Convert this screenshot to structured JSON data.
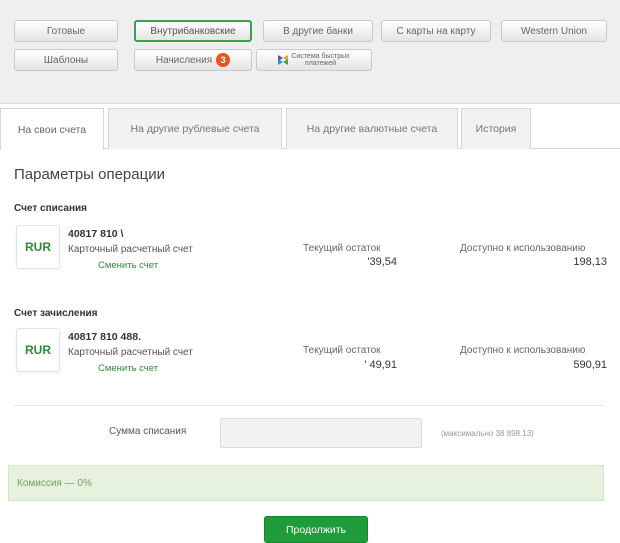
{
  "top_menu": {
    "row1": [
      "Готовые",
      "Внутрибанковские",
      "В другие банки",
      "С карты на карту",
      "Western Union"
    ],
    "row2": {
      "templates": "Шаблоны",
      "charges": "Начисления",
      "charges_badge": "3",
      "sbp_line1": "Система быстрых",
      "sbp_line2": "платежей"
    }
  },
  "tabs": [
    "На свои счета",
    "На другие рублевые счета",
    "На другие валютные счета",
    "История"
  ],
  "params": {
    "title": "Параметры операции",
    "debit_label": "Счет списания",
    "credit_label": "Счет зачисления"
  },
  "debit_account": {
    "currency": "RUR",
    "number": "40817 810 \\",
    "type": "Карточный расчетный счет",
    "change_link": "Сменить счет",
    "current_balance_label": "Текущий остаток",
    "current_balance": "'39,54",
    "available_label": "Доступно к использованию",
    "available": "198,13"
  },
  "credit_account": {
    "currency": "RUR",
    "number": "40817 810 488.",
    "type": "Карточный расчетный счет",
    "change_link": "Сменить счет",
    "current_balance_label": "Текущий остаток",
    "current_balance": "' 49,91",
    "available_label": "Доступно к использованию",
    "available": "590,91"
  },
  "amount": {
    "label": "Сумма списания",
    "value": "",
    "max_hint": "(максимально 38 898.13)"
  },
  "commission": "Комиссия — 0%",
  "continue_button": "Продолжить",
  "colors": {
    "accent": "#1f9b3a",
    "badge": "#e8541b",
    "commission_bg": "#e7f2de"
  }
}
